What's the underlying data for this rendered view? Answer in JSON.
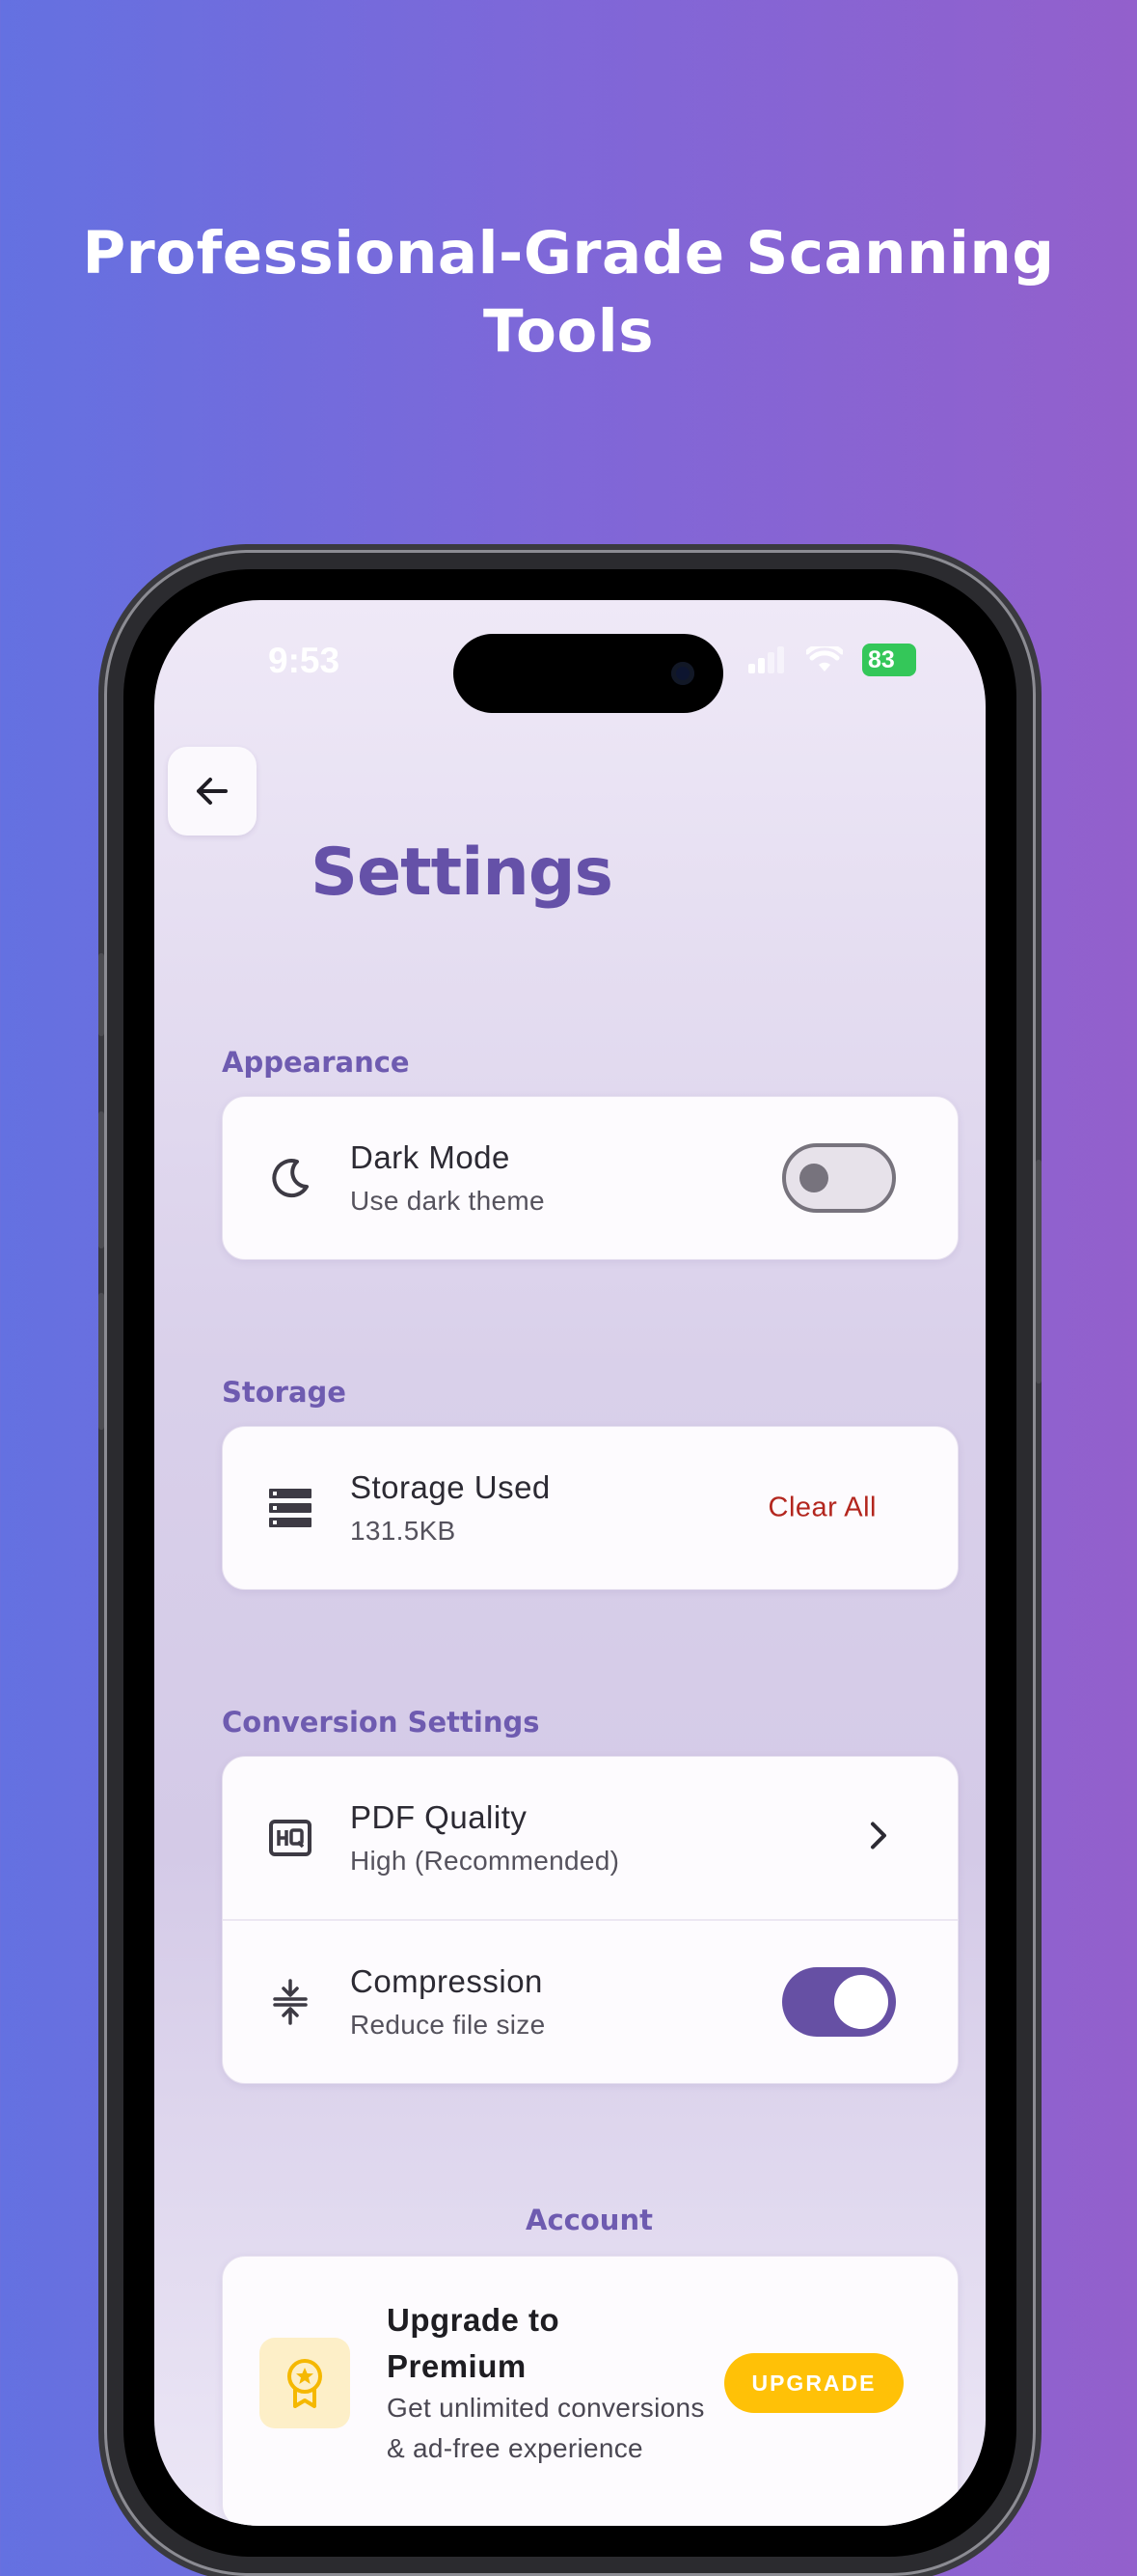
{
  "marketing": {
    "headline_line1": "Professional-Grade Scanning",
    "headline_line2": "Tools"
  },
  "status_bar": {
    "time": "9:53",
    "battery": "83"
  },
  "header": {
    "back_icon": "arrow-left-icon",
    "title": "Settings"
  },
  "sections": {
    "appearance": {
      "label": "Appearance",
      "dark_mode": {
        "title": "Dark Mode",
        "subtitle": "Use dark theme",
        "icon": "moon-icon",
        "enabled": false
      }
    },
    "storage": {
      "label": "Storage",
      "storage_used": {
        "title": "Storage Used",
        "subtitle": "131.5KB",
        "icon": "storage-icon",
        "action": "Clear All"
      }
    },
    "conversion": {
      "label": "Conversion Settings",
      "pdf_quality": {
        "title": "PDF Quality",
        "subtitle": "High (Recommended)",
        "icon": "hq-icon"
      },
      "compression": {
        "title": "Compression",
        "subtitle": "Reduce file size",
        "icon": "compress-icon",
        "enabled": true
      }
    },
    "account": {
      "label": "Account",
      "premium": {
        "title": "Upgrade to Premium",
        "subtitle": "Get unlimited conversions & ad-free experience",
        "icon": "premium-badge-icon",
        "button": "UPGRADE"
      }
    }
  },
  "colors": {
    "accent": "#6650a4",
    "section_label": "#6e5bb0",
    "danger": "#b3261e",
    "upgrade": "#ffc107",
    "battery": "#34c759"
  }
}
